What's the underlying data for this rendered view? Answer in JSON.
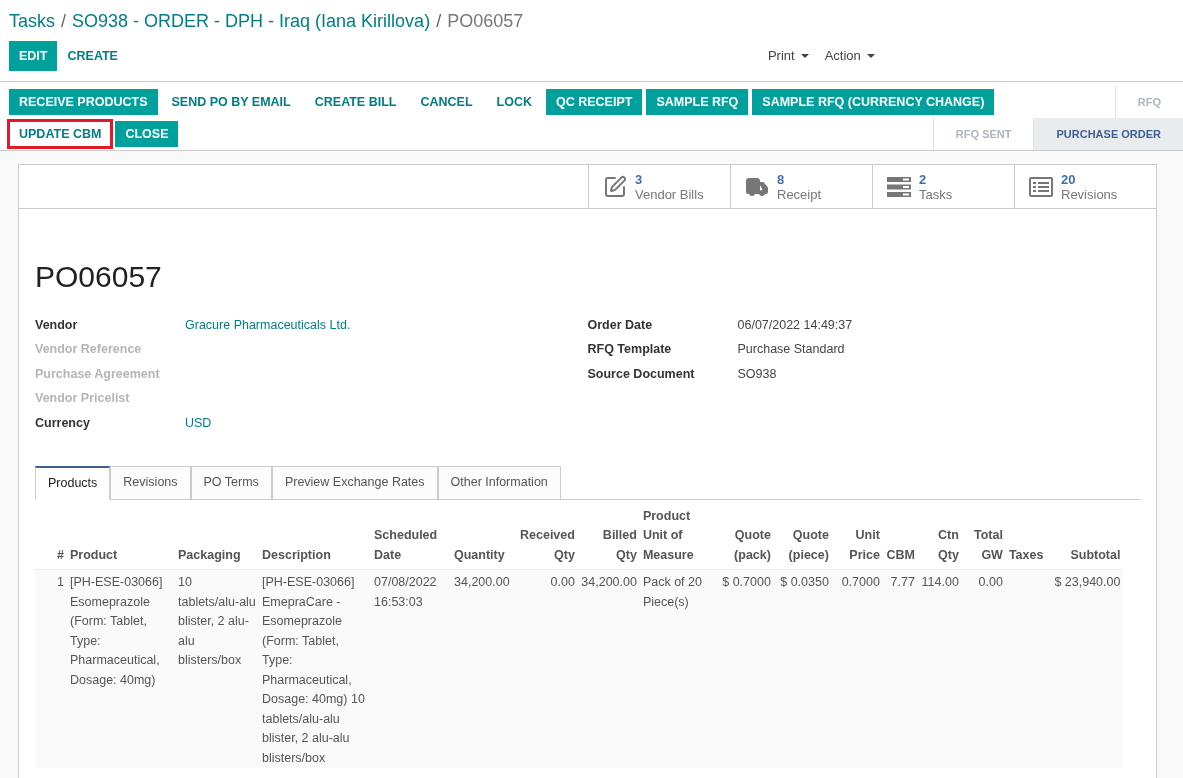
{
  "breadcrumbs": [
    {
      "label": "Tasks",
      "current": false
    },
    {
      "separator": "/",
      "label": "SO938 - ORDER - DPH - Iraq (Iana Kirillova)",
      "current": false
    },
    {
      "separator": "/",
      "label": "PO06057",
      "current": true
    }
  ],
  "control_buttons": [
    {
      "label": "EDIT",
      "kind": "primary"
    },
    {
      "label": "CREATE",
      "kind": "link"
    }
  ],
  "dropdowns": [
    "Print",
    "Action"
  ],
  "action_rows": [
    {
      "buttons": [
        {
          "label": "RECEIVE PRODUCTS",
          "kind": "primary",
          "highlighted": false
        },
        {
          "label": "SEND PO BY EMAIL",
          "kind": "link",
          "highlighted": false
        },
        {
          "label": "CREATE BILL",
          "kind": "link",
          "highlighted": false
        },
        {
          "label": "CANCEL",
          "kind": "link",
          "highlighted": false
        },
        {
          "label": "LOCK",
          "kind": "link",
          "highlighted": false
        },
        {
          "label": "QC RECEIPT",
          "kind": "primary",
          "highlighted": false
        },
        {
          "label": "SAMPLE RFQ",
          "kind": "primary",
          "highlighted": false
        },
        {
          "label": "SAMPLE RFQ (CURRENCY CHANGE)",
          "kind": "primary",
          "highlighted": false
        }
      ],
      "stages": [
        {
          "label": "RFQ",
          "selected": false
        }
      ]
    },
    {
      "buttons": [
        {
          "label": "UPDATE CBM",
          "kind": "link",
          "highlighted": true
        },
        {
          "label": "CLOSE",
          "kind": "primary",
          "highlighted": false
        }
      ],
      "stages": [
        {
          "label": "RFQ SENT",
          "selected": false
        },
        {
          "label": "PURCHASE ORDER",
          "selected": true
        }
      ]
    }
  ],
  "smart_buttons": [
    {
      "kind": "bills",
      "count": "3",
      "label": "Vendor Bills"
    },
    {
      "kind": "receipt",
      "count": "8",
      "label": "Receipt"
    },
    {
      "kind": "tasks",
      "count": "2",
      "label": "Tasks"
    },
    {
      "kind": "revisions",
      "count": "20",
      "label": "Revisions"
    }
  ],
  "record_title": "PO06057",
  "fields_left": [
    {
      "label": "Vendor",
      "value": "Gracure Pharmaceuticals Ltd.",
      "empty": false,
      "kind": "link"
    },
    {
      "label": "Vendor Reference",
      "empty": true
    },
    {
      "label": "Purchase Agreement",
      "empty": true
    },
    {
      "label": "Vendor Pricelist",
      "empty": true
    },
    {
      "label": "Currency",
      "value": "USD",
      "empty": false,
      "kind": "link"
    }
  ],
  "fields_right": [
    {
      "label": "Order Date",
      "value": "06/07/2022 14:49:37",
      "empty": false,
      "kind": "text"
    },
    {
      "label": "RFQ Template",
      "value": "Purchase Standard",
      "empty": false,
      "kind": "text"
    },
    {
      "label": "Source Document",
      "value": "SO938",
      "empty": false,
      "kind": "text"
    }
  ],
  "tabs": [
    {
      "label": "Products",
      "selected": true
    },
    {
      "label": "Revisions",
      "selected": false
    },
    {
      "label": "PO Terms",
      "selected": false
    },
    {
      "label": "Preview Exchange Rates",
      "selected": false
    },
    {
      "label": "Other Information",
      "selected": false
    }
  ],
  "table": {
    "columns": [
      "#",
      "Product",
      "Packaging",
      "Description",
      "Scheduled Date",
      "Quantity",
      "Received Qty",
      "Billed Qty",
      "Product Unit of Measure",
      "Quote (pack)",
      "Quote (piece)",
      "Unit Price",
      "CBM",
      "Ctn Qty",
      "Total GW",
      "Taxes",
      "Subtotal"
    ],
    "rows": [
      [
        "1",
        "[PH-ESE-03066] Esomeprazole (Form: Tablet, Type: Pharmaceutical, Dosage: 40mg)",
        "10 tablets/alu-alu blister, 2 alu-alu blisters/box",
        "[PH-ESE-03066] EmepraCare - Esomeprazole (Form: Tablet, Type: Pharmaceutical, Dosage: 40mg) 10 tablets/alu-alu blister, 2 alu-alu blisters/box",
        "07/08/2022 16:53:03",
        "34,200.00",
        "0.00",
        "34,200.00",
        "Pack of 20 Piece(s)",
        "$ 0.7000",
        "$ 0.0350",
        "0.7000",
        "7.77",
        "114.00",
        "0.00",
        "",
        "$ 23,940.00"
      ]
    ]
  }
}
